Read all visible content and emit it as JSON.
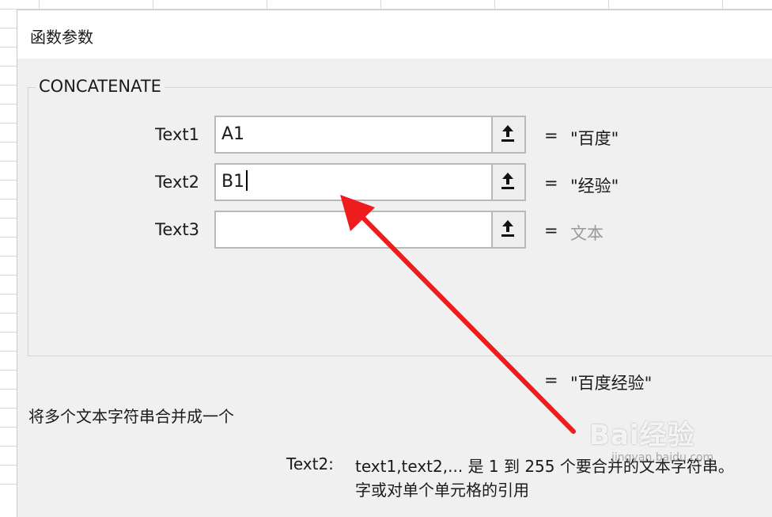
{
  "dialog": {
    "title": "函数参数",
    "function_name": "CONCATENATE"
  },
  "arguments": [
    {
      "label": "Text1",
      "value": "A1",
      "result": "= \"百度\"",
      "result_placeholder": false
    },
    {
      "label": "Text2",
      "value": "B1",
      "result": "= \"经验\"",
      "result_placeholder": false
    },
    {
      "label": "Text3",
      "value": "",
      "result": "= 文本",
      "result_placeholder": true
    }
  ],
  "formula_result": {
    "eq": "=",
    "value": "\"百度经验\""
  },
  "description": "将多个文本字符串合并成一个",
  "help": {
    "arg_name": "Text2:",
    "text_line1": "text1,text2,... 是 1 到 255 个要合并的文本字符串。",
    "text_line2": "字或对单个单元格的引用"
  },
  "icons": {
    "collapse": "collapse-dialog-icon",
    "annotation": "red-arrow-annotation"
  },
  "colors": {
    "annotation_arrow": "#ee1c1c",
    "placeholder_text": "#9a9a9a"
  },
  "watermark": {
    "logo": "Bai经验",
    "sub": "jingyan.baidu.com"
  }
}
